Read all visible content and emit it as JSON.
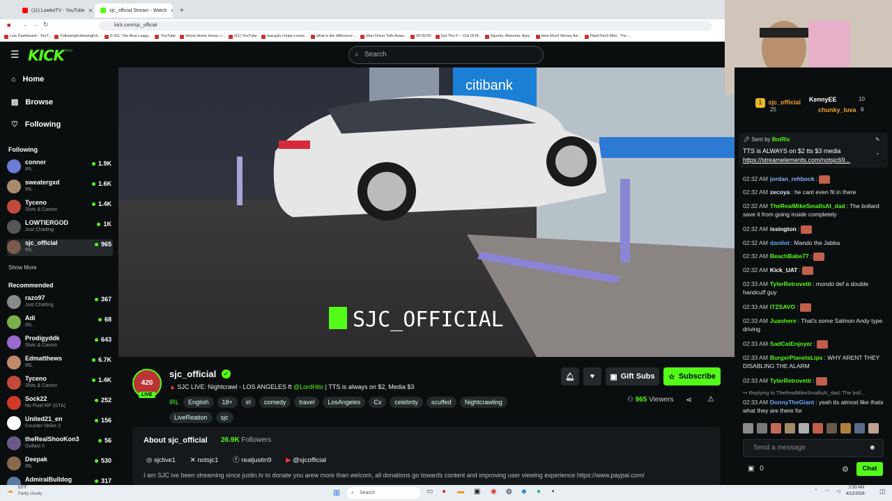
{
  "browser": {
    "tabs": [
      {
        "label": "(11) LowkoTV - YouTube"
      },
      {
        "label": "sjc_official Stream - Watch"
      }
    ],
    "url": "kick.com/sjc_official",
    "bookmarks": [
      "Live Dashboard - YouT..",
      "FollowingFollowingFol..",
      "D GG: The Best Leagu..",
      "YouTube",
      "Home Home Home, c..",
      "(61) YouTube",
      "macaylu i-hope-i-neve..",
      "what is the difference ..",
      "Uber Driver Tells Asian..",
      "00:00:00",
      "Get The F--- Out Of M..",
      "Squints, Mamoita: Asia..",
      "How Much Money Asi..",
      "FlashTorch Mini - The ..."
    ]
  },
  "header": {
    "logo": "KICK",
    "logo_badge": "BETA",
    "search_placeholder": "Search"
  },
  "nav": {
    "home": "Home",
    "browse": "Browse",
    "following": "Following"
  },
  "sidebar": {
    "following_title": "Following",
    "following": [
      {
        "name": "conner",
        "cat": "IRL",
        "viewers": "1.9K",
        "color": "#6b7dd6"
      },
      {
        "name": "sweatergxd",
        "cat": "IRL",
        "viewers": "1.6K",
        "color": "#a88a6a"
      },
      {
        "name": "Tyceno",
        "cat": "Slots & Casino",
        "viewers": "1.4K",
        "color": "#c24a3a"
      },
      {
        "name": "LOWTIERGOD",
        "cat": "Just Chatting",
        "viewers": "1K",
        "color": "#555"
      },
      {
        "name": "sjc_official",
        "cat": "IRL",
        "viewers": "965",
        "color": "#7a5a4a"
      }
    ],
    "show_more": "Show More",
    "recommended_title": "Recommended",
    "recommended": [
      {
        "name": "razo97",
        "cat": "Just Chatting",
        "viewers": "367",
        "color": "#8a8a8a"
      },
      {
        "name": "Adi",
        "cat": "IRL",
        "viewers": "68",
        "color": "#7bb04a"
      },
      {
        "name": "Prodigyddk",
        "cat": "Slots & Casino",
        "viewers": "643",
        "color": "#9a6ad0"
      },
      {
        "name": "Edmatthews",
        "cat": "IRL",
        "viewers": "6.7K",
        "color": "#c08a6a"
      },
      {
        "name": "Tyceno",
        "cat": "Slots & Casino",
        "viewers": "1.4K",
        "color": "#c24a3a"
      },
      {
        "name": "Sock22",
        "cat": "No Pixel RP (GTA)",
        "viewers": "252",
        "color": "#d03a2a"
      },
      {
        "name": "United21_en",
        "cat": "Counter-Strike 2",
        "viewers": "156",
        "color": "#fff"
      },
      {
        "name": "theRealShooKon3",
        "cat": "Outlast II",
        "viewers": "56",
        "color": "#6a5a8a"
      },
      {
        "name": "Deepak",
        "cat": "IRL",
        "viewers": "530",
        "color": "#8a6a4a"
      },
      {
        "name": "AdmiralBulldog",
        "cat": "",
        "viewers": "317",
        "color": "#5a7aa0"
      }
    ]
  },
  "video": {
    "overlay_logo": "K",
    "overlay_text": "SJC_OFFICIAL",
    "sign": "citibank"
  },
  "stream": {
    "channel": "sjc_official",
    "avatar_text": "420",
    "live": "LIVE",
    "title_prefix": "SJC LIVE: Nightcrawl - LOS ANGELES ft ",
    "title_mention": "@LordHito",
    "title_suffix": " | TTS is always on $2, Media $3",
    "category": "IRL",
    "tags": [
      "English",
      "18+",
      "irl",
      "comedy",
      "travel",
      "LosAngeles",
      "Cx",
      "celebrity",
      "scuffed",
      "Nightcrawling",
      "LiveReation",
      "sjc"
    ],
    "viewers": "965",
    "viewers_label": "Viewers",
    "gift_subs": "Gift Subs",
    "subscribe": "Subscribe",
    "about_title": "About sjc_official",
    "followers": "26.9K",
    "followers_label": "Followers",
    "socials": [
      "sjclive1",
      "notsjc1",
      "realjustin9",
      "@sjcofficial"
    ],
    "bio": "I am SJC ive been streaming since justin.tv to donate you arew more than welcom, all donations go towards content and improving user viewing experience https://www.paypal.com/"
  },
  "chat": {
    "leaderboard": [
      {
        "name": "sjc_official",
        "count": "25"
      },
      {
        "name": "KennyEE",
        "count": "10"
      },
      {
        "name": "chunky_luva",
        "count": "8"
      }
    ],
    "pinned_sent_by": "Sent by",
    "pinned_user": "BotRix",
    "pinned_text": "TTS is ALWAYS on $2 tts $3 media",
    "pinned_link": "https://streamelements.com/notsjc69...",
    "messages": [
      {
        "time": "02:32 AM",
        "user": "jordan_rehbock",
        "text": "",
        "color": "#8ab4ff",
        "emote": true
      },
      {
        "time": "02:32 AM",
        "user": "zecoya",
        "text": "he cant even fit in there",
        "color": "#dfe3ff"
      },
      {
        "time": "02:32 AM",
        "user": "TheRealMikeSmallsAI_dad",
        "text": "The bollard save it from going inside completely",
        "color": "#53fc18"
      },
      {
        "time": "02:32 AM",
        "user": "issington",
        "text": "",
        "color": "#fff",
        "emote": true
      },
      {
        "time": "02:32 AM",
        "user": "danilot",
        "text": "Mando the Jabba",
        "color": "#6aa8ff"
      },
      {
        "time": "02:32 AM",
        "user": "BeachBabe77",
        "text": "",
        "color": "#53fc18",
        "emote": true
      },
      {
        "time": "02:32 AM",
        "user": "Kick_UAT",
        "text": "",
        "color": "#fff",
        "emote": true
      },
      {
        "time": "02:33 AM",
        "user": "TylerRetrovetti",
        "text": "mondo def a double handcuff guy",
        "color": "#53fc18"
      },
      {
        "time": "02:33 AM",
        "user": "ITZSAVO",
        "text": "",
        "color": "#53fc18",
        "emote": true
      },
      {
        "time": "02:33 AM",
        "user": "Juanhere",
        "text": "That's some Salmon Andy type driving",
        "color": "#53fc18"
      },
      {
        "time": "02:33 AM",
        "user": "SadCatEnjoyer",
        "text": "",
        "color": "#53fc18",
        "emote": true
      },
      {
        "time": "02:33 AM",
        "user": "BurgerPlanetsLips",
        "text": "WHY ARENT THEY DISABLING THE ALARM",
        "color": "#53fc18"
      },
      {
        "time": "02:33 AM",
        "user": "TylerRetrovetti",
        "text": "",
        "color": "#53fc18",
        "emote": true
      }
    ],
    "reply_text": "Replying to TheRealMikeSmallsAI_dad: The boll...",
    "reply_msg": {
      "time": "02:33 AM",
      "user": "DonnyTheGiant",
      "text": "yeah its almost like thats what they are there for",
      "color": "#6aa8ff"
    },
    "input_placeholder": "Send a message",
    "points": "0",
    "chat_button": "Chat"
  },
  "taskbar": {
    "weather_temp": "53°F",
    "weather_desc": "Partly cloudy",
    "search": "Search",
    "time": "2:33 AM",
    "date": "4/12/2026"
  }
}
